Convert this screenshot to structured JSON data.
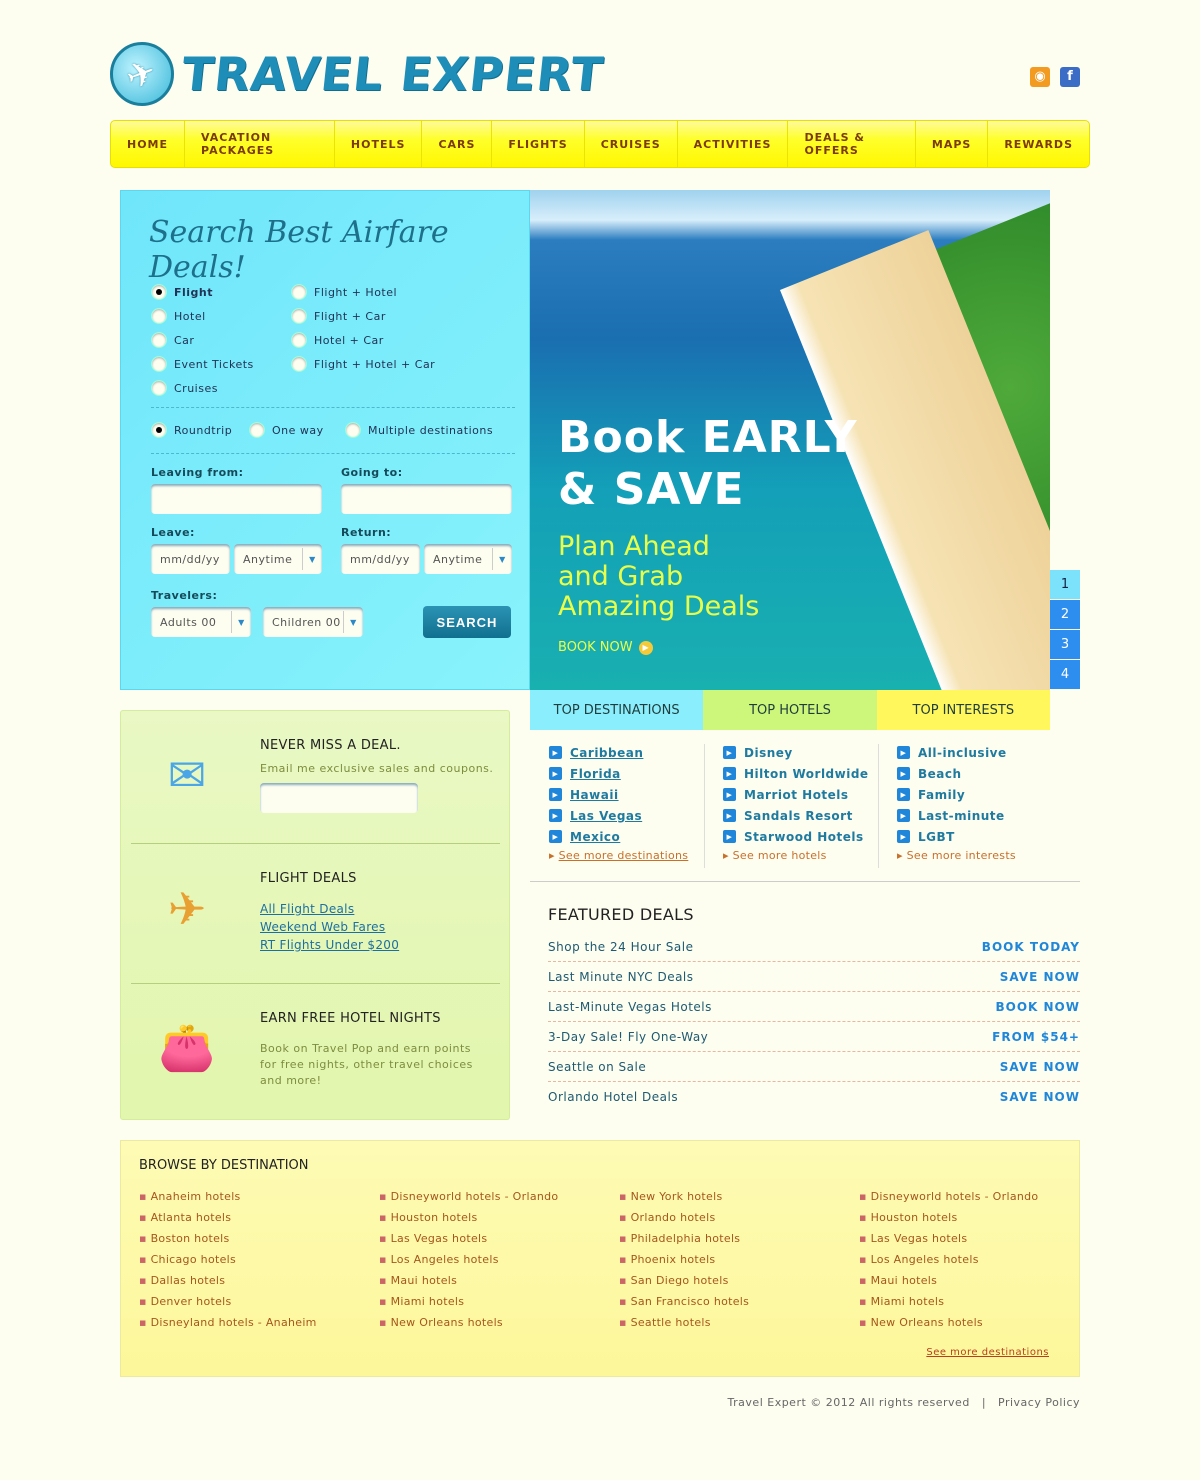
{
  "header": {
    "brand": "TRAVEL EXPERT",
    "social": [
      {
        "icon": "rss-icon",
        "color": "#f39a21"
      },
      {
        "icon": "facebook-icon",
        "color": "#3b6cc6"
      }
    ]
  },
  "nav": [
    "HOME",
    "VACATION PACKAGES",
    "HOTELS",
    "CARS",
    "FLIGHTS",
    "CRUISES",
    "ACTIVITIES",
    "DEALS & OFFERS",
    "MAPS",
    "REWARDS"
  ],
  "search": {
    "title": "Search Best Airfare Deals!",
    "types_left": [
      "Flight",
      "Hotel",
      "Car",
      "Event Tickets",
      "Cruises"
    ],
    "types_right": [
      "Flight + Hotel",
      "Flight + Car",
      "Hotel + Car",
      "Flight + Hotel + Car"
    ],
    "selected_type": "Flight",
    "trip": [
      "Roundtrip",
      "One way",
      "Multiple destinations"
    ],
    "selected_trip": "Roundtrip",
    "leaving_label": "Leaving from:",
    "going_label": "Going to:",
    "leave_label": "Leave:",
    "return_label": "Return:",
    "date_placeholder": "mm/dd/yy",
    "time_value": "Anytime",
    "travelers_label": "Travelers:",
    "adults": "Adults 00",
    "children": "Children 00",
    "button": "SEARCH"
  },
  "hero": {
    "headline1": "Book EARLY",
    "headline2": "& SAVE",
    "sub1": "Plan Ahead",
    "sub2": "and Grab",
    "sub3": "Amazing Deals",
    "cta": "BOOK NOW",
    "pages": [
      "1",
      "2",
      "3",
      "4"
    ],
    "active_page": "1"
  },
  "promo": {
    "newsletter": {
      "title": "NEVER MISS A DEAL.",
      "text": "Email me exclusive sales and coupons."
    },
    "flights": {
      "title": "FLIGHT DEALS",
      "links": [
        "All Flight Deals",
        "Weekend Web Fares",
        "RT Flights Under $200"
      ]
    },
    "hotels": {
      "title": "EARN FREE HOTEL NIGHTS",
      "text": "Book on Travel Pop and earn points for free nights, other travel choices and more!"
    }
  },
  "tabs": [
    {
      "label": "TOP DESTINATIONS",
      "color": "#8beefc"
    },
    {
      "label": "TOP HOTELS",
      "color": "#cdf77a"
    },
    {
      "label": "TOP INTERESTS",
      "color": "#fff75c"
    }
  ],
  "lists": {
    "destinations": [
      "Caribbean",
      "Florida",
      "Hawaii",
      "Las Vegas",
      "Mexico"
    ],
    "destinations_more": "See more destinations",
    "hotels": [
      "Disney",
      "Hilton Worldwide",
      "Marriot Hotels",
      "Sandals Resort",
      "Starwood Hotels"
    ],
    "hotels_more": "See more hotels",
    "interests": [
      "All-inclusive",
      "Beach",
      "Family",
      "Last-minute",
      "LGBT"
    ],
    "interests_more": "See more interests"
  },
  "featured": {
    "title": "FEATURED DEALS",
    "deals": [
      {
        "name": "Shop the 24 Hour Sale",
        "action": "BOOK TODAY"
      },
      {
        "name": "Last Minute NYC Deals",
        "action": "SAVE NOW"
      },
      {
        "name": "Last-Minute Vegas Hotels",
        "action": "BOOK NOW"
      },
      {
        "name": "3-Day Sale! Fly One-Way",
        "action": "FROM $54+"
      },
      {
        "name": "Seattle on Sale",
        "action": "SAVE NOW"
      },
      {
        "name": "Orlando Hotel Deals",
        "action": "SAVE NOW"
      }
    ]
  },
  "browse": {
    "title": "BROWSE BY DESTINATION",
    "columns": [
      [
        "Anaheim hotels",
        "Atlanta hotels",
        "Boston hotels",
        "Chicago hotels",
        "Dallas hotels",
        "Denver hotels",
        "Disneyland hotels - Anaheim"
      ],
      [
        "Disneyworld hotels - Orlando",
        "Houston hotels",
        "Las Vegas hotels",
        "Los Angeles hotels",
        "Maui hotels",
        "Miami hotels",
        "New Orleans hotels"
      ],
      [
        "New York hotels",
        "Orlando hotels",
        "Philadelphia hotels",
        "Phoenix hotels",
        "San Diego hotels",
        "San Francisco hotels",
        "Seattle hotels"
      ],
      [
        "Disneyworld hotels - Orlando",
        "Houston hotels",
        "Las Vegas hotels",
        "Los Angeles hotels",
        "Maui hotels",
        "Miami hotels",
        "New Orleans hotels"
      ]
    ],
    "more": "See more destinations"
  },
  "footer": {
    "copyright": "Travel Expert  © 2012 All rights reserved",
    "separator": "|",
    "privacy": "Privacy Policy"
  }
}
